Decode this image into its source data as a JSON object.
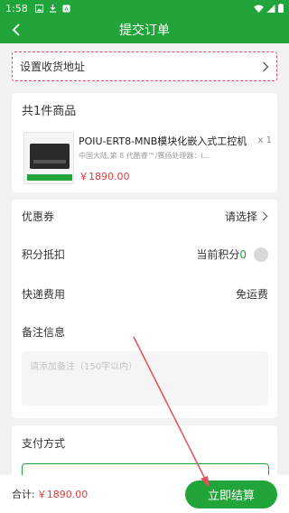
{
  "status_bar": {
    "time": "1:58"
  },
  "nav": {
    "title": "提交订单"
  },
  "address": {
    "label": "设置收货地址"
  },
  "goods": {
    "header": "共1件商品",
    "items": [
      {
        "name": "POIU-ERT8-MNB模块化嵌入式工控机",
        "qty": "x 1",
        "desc": "中国大陆,第 8 代酷睿™/赛扬处理器：i…",
        "price": "￥1890.00"
      }
    ]
  },
  "options": {
    "coupon": {
      "label": "优惠券",
      "value": "请选择"
    },
    "points": {
      "label": "积分抵扣",
      "prefix": "当前积分",
      "value": "0"
    },
    "shipping": {
      "label": "快递费用",
      "value": "免运费"
    },
    "remark": {
      "label": "备注信息",
      "placeholder": "请添加备注（150字以内）"
    }
  },
  "payment": {
    "label": "支付方式"
  },
  "bottom": {
    "total_label": "合计:",
    "total": "￥1890.00",
    "submit": "立即结算"
  },
  "colors": {
    "brand": "#21a53a",
    "price": "#e23b3b",
    "annotation": "#e0525a"
  }
}
